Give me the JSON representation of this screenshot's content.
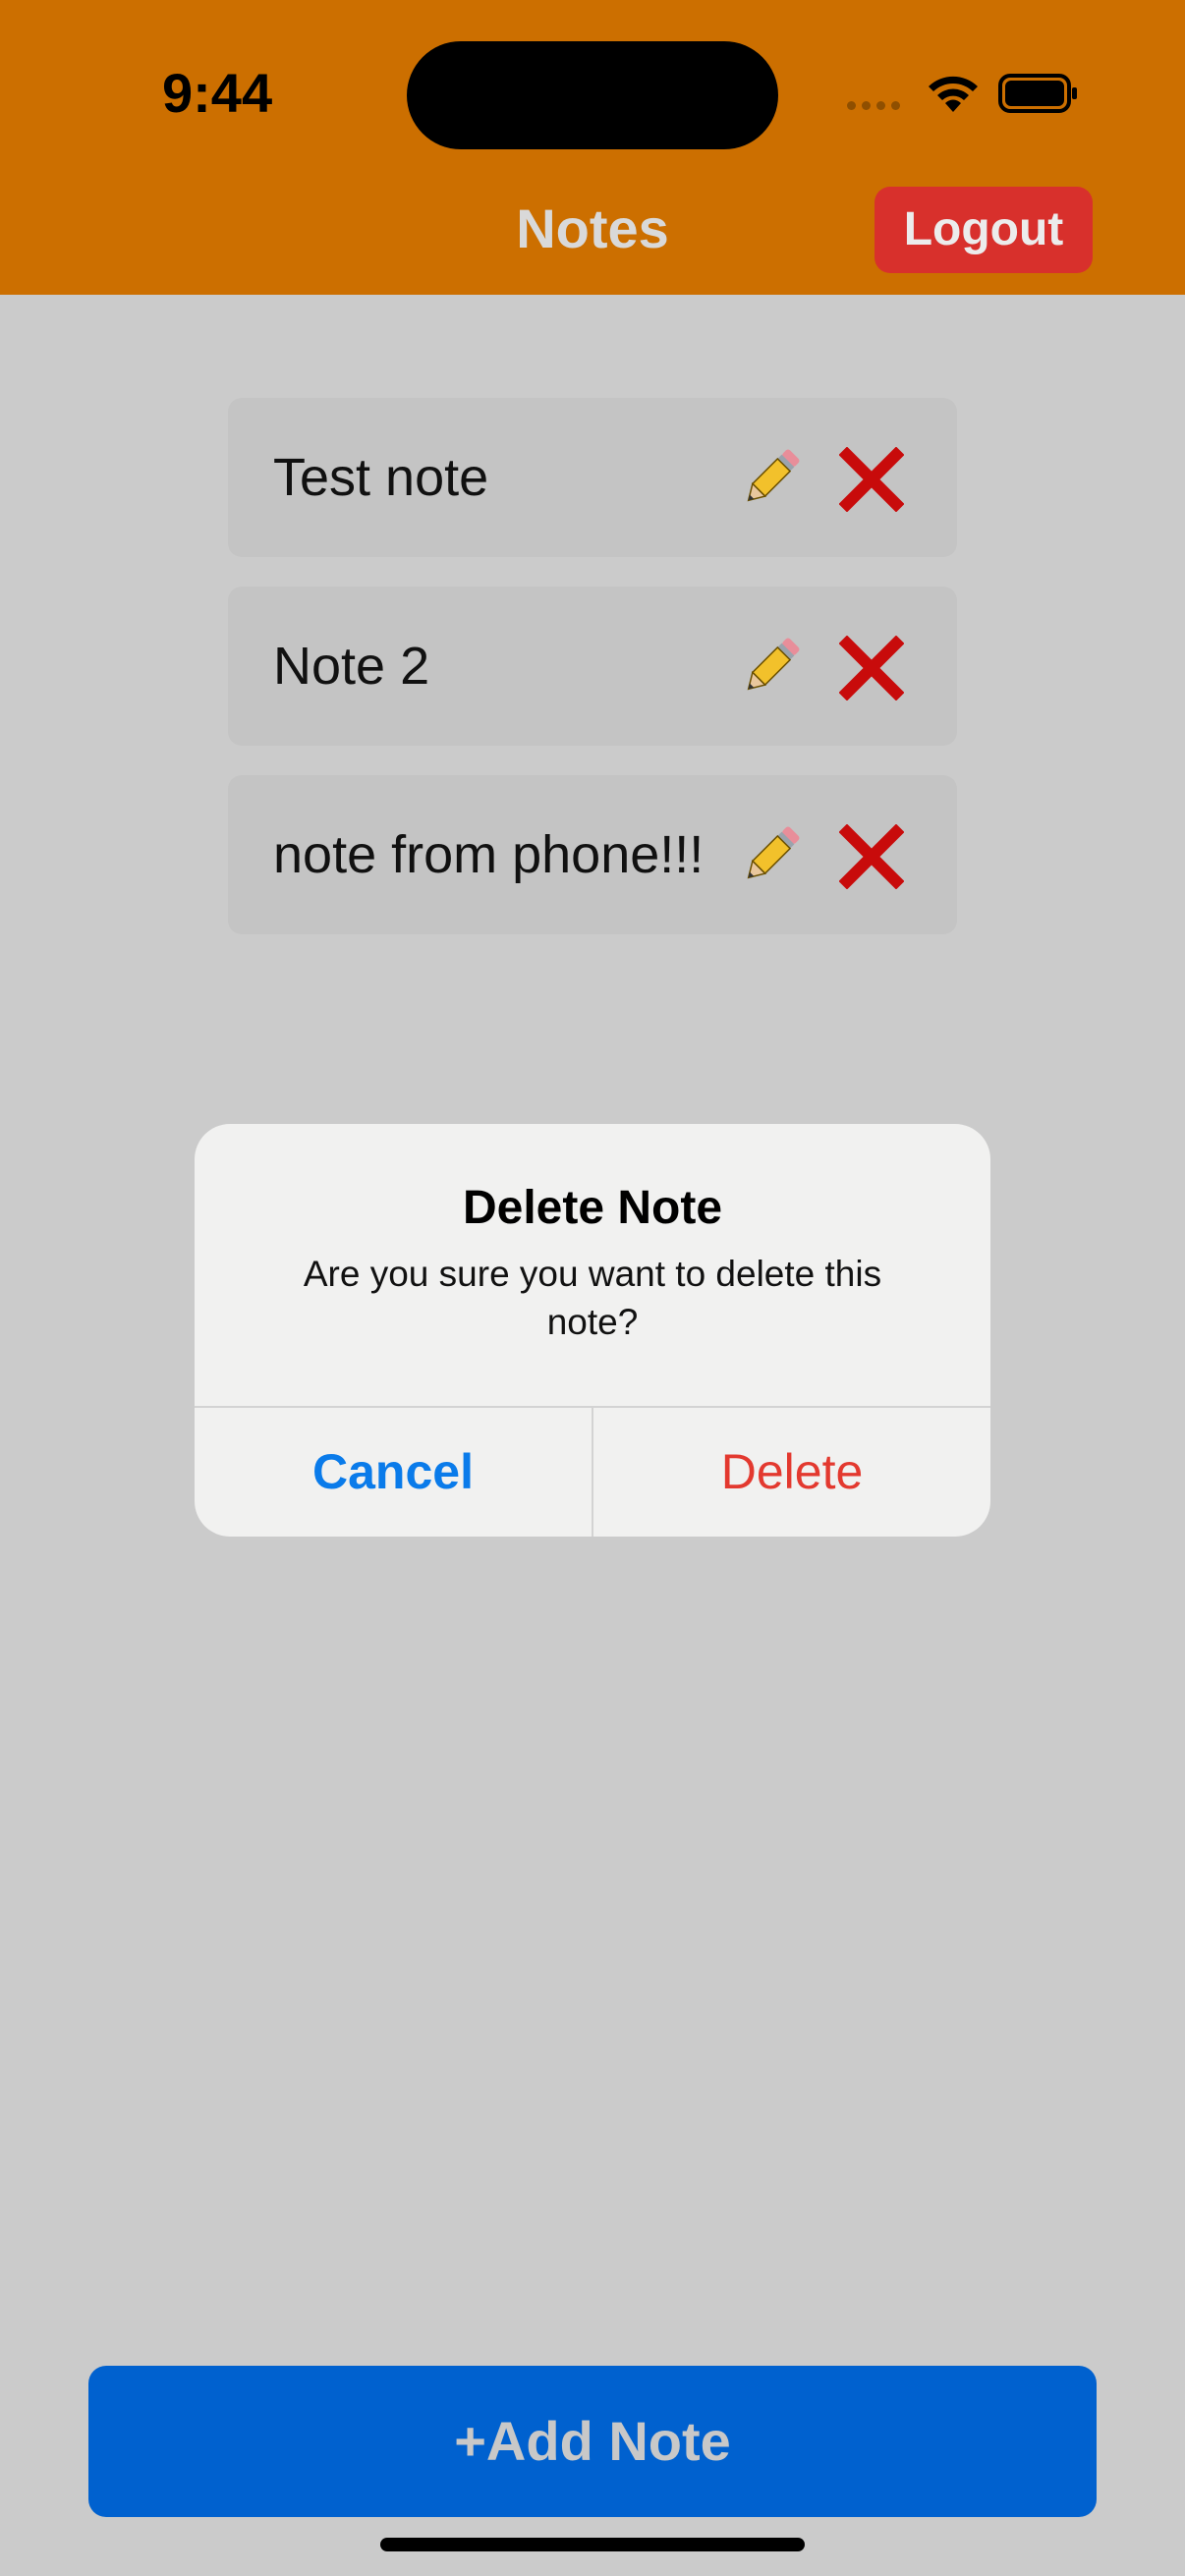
{
  "status_bar": {
    "time": "9:44"
  },
  "nav": {
    "title": "Notes",
    "logout_label": "Logout"
  },
  "notes": [
    {
      "text": "Test note",
      "edit_icon": "pencil-icon",
      "delete_icon": "x-icon"
    },
    {
      "text": "Note 2",
      "edit_icon": "pencil-icon",
      "delete_icon": "x-icon"
    },
    {
      "text": "note from phone!!!",
      "edit_icon": "pencil-icon",
      "delete_icon": "x-icon"
    }
  ],
  "alert": {
    "title": "Delete Note",
    "message": "Are you sure you want to delete this note?",
    "cancel_label": "Cancel",
    "delete_label": "Delete"
  },
  "add_button_label": "+Add Note",
  "colors": {
    "header": "#cc6f00",
    "background": "#cbcbcb",
    "logout": "#d8302c",
    "add_button": "#0061cf",
    "cancel": "#0a7bea",
    "destructive": "#e3392f"
  }
}
